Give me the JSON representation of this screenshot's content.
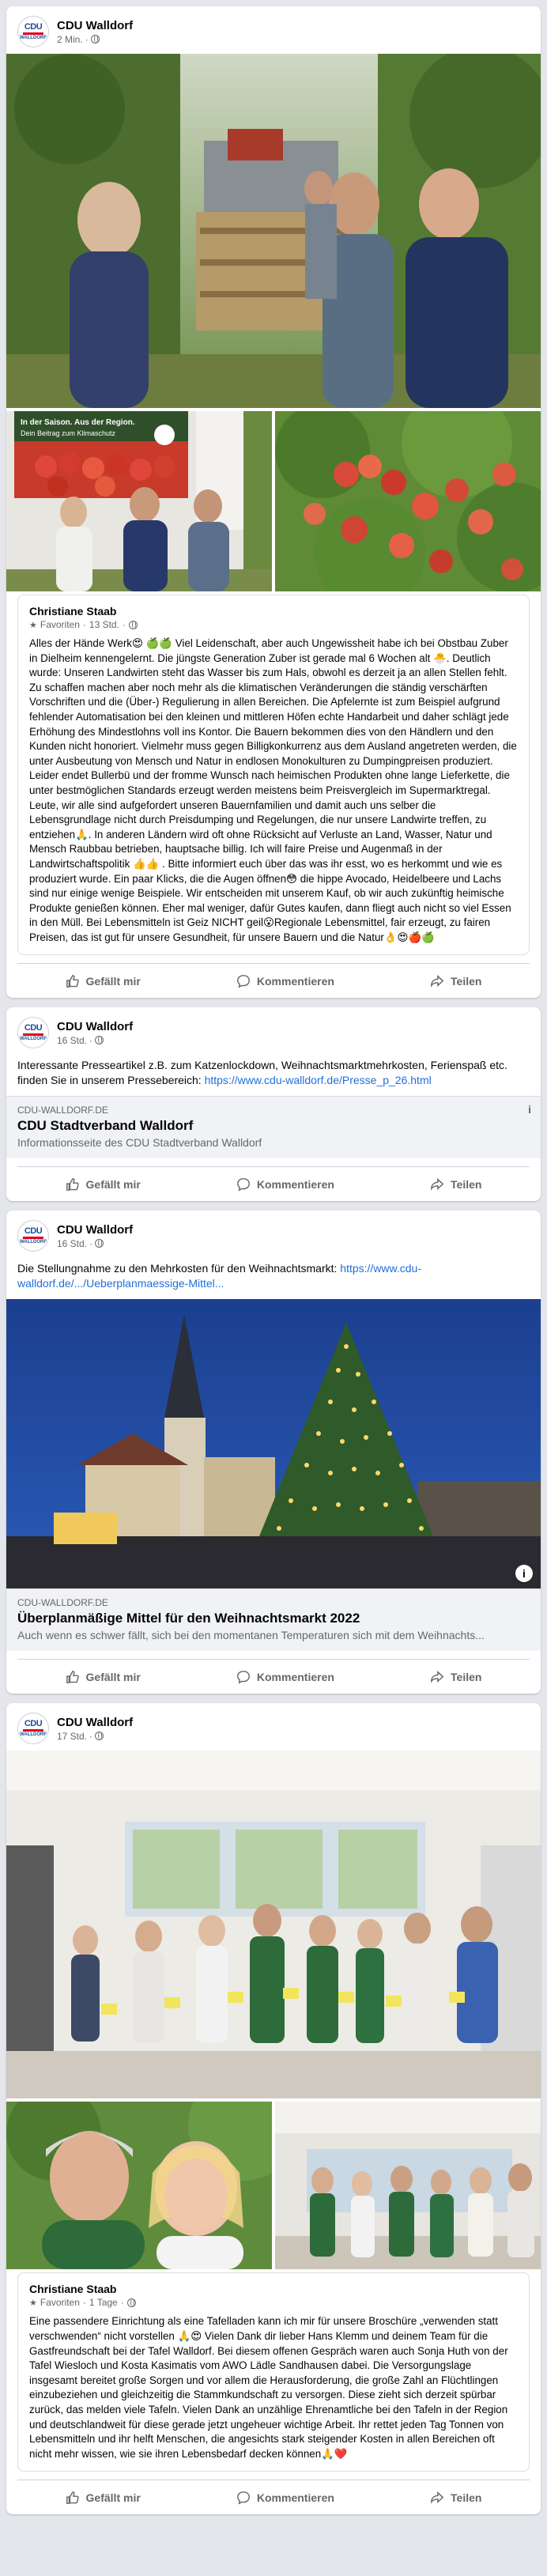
{
  "page": {
    "name": "CDU Walldorf",
    "logo_top": "CDU",
    "logo_bottom": "WALLDORF"
  },
  "actions": {
    "like": "Gefällt mir",
    "comment": "Kommentieren",
    "share": "Teilen"
  },
  "icons": {
    "like": "thumbs-up-icon",
    "comment": "speech-bubble-icon",
    "share": "share-arrow-icon",
    "audience": "globe-icon",
    "favorite": "star-icon",
    "info": "info-icon"
  },
  "colors": {
    "brand_blue": "#1d4f9c",
    "brand_red": "#e2001a",
    "link": "#216fdb",
    "muted": "#65676b"
  },
  "posts": [
    {
      "time": "2 Min.",
      "photo_banner_line1": "In der Saison. Aus der Region.",
      "photo_banner_line2": "Dein Beitrag zum Klimaschutz",
      "caption_author": "Christiane Staab",
      "caption_meta_fav": "Favoriten",
      "caption_meta_time": "13 Std.",
      "caption_text": "Alles der Hände Werk😍 🍏🍏 Viel Leidenschaft, aber auch Ungewissheit habe ich bei Obstbau Zuber in Dielheim kennengelernt. Die jüngste Generation Zuber ist gerade mal 6 Wochen alt 🐣. Deutlich wurde: Unseren Landwirten steht das Wasser bis zum Hals, obwohl es derzeit ja an allen Stellen fehlt. Zu schaffen machen aber noch mehr als die klimatischen Veränderungen die ständig verschärften Vorschriften und die (Über-) Regulierung in allen Bereichen. Die Apfelernte ist zum Beispiel aufgrund fehlender Automatisation bei den kleinen und mittleren Höfen echte Handarbeit und daher schlägt jede Erhöhung des Mindestlohns voll ins Kontor. Die Bauern bekommen dies von den Händlern und den Kunden nicht honoriert. Vielmehr muss gegen Billigkonkurrenz aus dem Ausland angetreten werden, die unter Ausbeutung von Mensch und Natur in endlosen Monokulturen zu Dumpingpreisen produziert. Leider endet Bullerbü und der fromme Wunsch nach heimischen Produkten ohne lange Lieferkette, die unter bestmöglichen Standards erzeugt werden meistens beim Preisvergleich im Supermarktregal. Leute, wir alle sind aufgefordert unseren Bauernfamilien und damit auch uns selber die Lebensgrundlage nicht durch Preisdumping und Regelungen, die nur unsere Landwirte treffen, zu entziehen🙏. In anderen Ländern wird oft ohne Rücksicht auf Verluste an Land, Wasser, Natur und Mensch Raubbau betrieben, hauptsache billig. Ich will faire Preise und Augenmaß in der Landwirtschaftspolitik 👍👍 . Bitte informiert euch über das was ihr esst, wo es herkommt und wie es produziert wurde. Ein paar Klicks, die die Augen öffnen😳 die hippe Avocado, Heidelbeere und Lachs sind nur einige wenige Beispiele. Wir entscheiden mit unserem Kauf, ob wir auch zukünftig heimische Produkte genießen können. Eher mal weniger, dafür Gutes kaufen, dann fliegt auch nicht so viel Essen in den Müll. Bei Lebensmitteln ist Geiz NICHT geil😮Regionale Lebensmittel, fair erzeugt, zu fairen Preisen, das ist gut für unsere Gesundheit, für unsere Bauern und die Natur👌😍🍎🍏"
    },
    {
      "time": "16 Std.",
      "text": "Interessante Presseartikel z.B. zum Katzenlockdown, Weihnachtsmarktmehrkosten, Ferienspaß etc. finden Sie in unserem Pressebereich: ",
      "link": "https://www.cdu-walldorf.de/Presse_p_26.html",
      "card_domain": "CDU-WALLDORF.DE",
      "card_title": "CDU Stadtverband Walldorf",
      "card_desc": "Informationsseite des CDU Stadtverband Walldorf"
    },
    {
      "time": "16 Std.",
      "text": "Die Stellungnahme zu den Mehrkosten für den Weihnachtsmarkt: ",
      "link": "https://www.cdu-walldorf.de/.../Ueberplanmaessige-Mittel...",
      "card_domain": "CDU-WALLDORF.DE",
      "card_title": "Überplanmäßige Mittel für den Weihnachtsmarkt 2022",
      "card_desc": "Auch wenn es schwer fällt, sich bei den momentanen Temperaturen sich mit dem Weihnachts..."
    },
    {
      "time": "17 Std.",
      "caption_author": "Christiane Staab",
      "caption_meta_fav": "Favoriten",
      "caption_meta_time": "1 Tage",
      "caption_text": "Eine passendere Einrichtung als eine Tafelladen kann ich mir für unsere Broschüre „verwenden statt verschwenden“ nicht vorstellen 🙏😍 Vielen Dank dir lieber Hans Klemm und deinem Team für die Gastfreundschaft bei der Tafel Walldorf. Bei diesem offenen Gespräch waren auch Sonja Huth von der Tafel Wiesloch und Kosta Kasimatis vom AWO Lädle Sandhausen dabei. Die Versorgungslage insgesamt bereitet große Sorgen und vor allem die Herausforderung, die große Zahl an Flüchtlingen einzubeziehen und gleichzeitig die Stammkundschaft zu versorgen. Diese zieht sich derzeit spürbar zurück, das melden viele Tafeln. Vielen Dank an unzählige Ehrenamtliche bei den Tafeln in der Region und deutschlandweit für diese gerade jetzt ungeheuer wichtige Arbeit. Ihr rettet jeden Tag Tonnen von Lebensmitteln und ihr helft Menschen, die angesichts stark steigender Kosten in allen Bereichen oft nicht mehr wissen, wie sie ihren Lebensbedarf decken können🙏❤️"
    }
  ]
}
